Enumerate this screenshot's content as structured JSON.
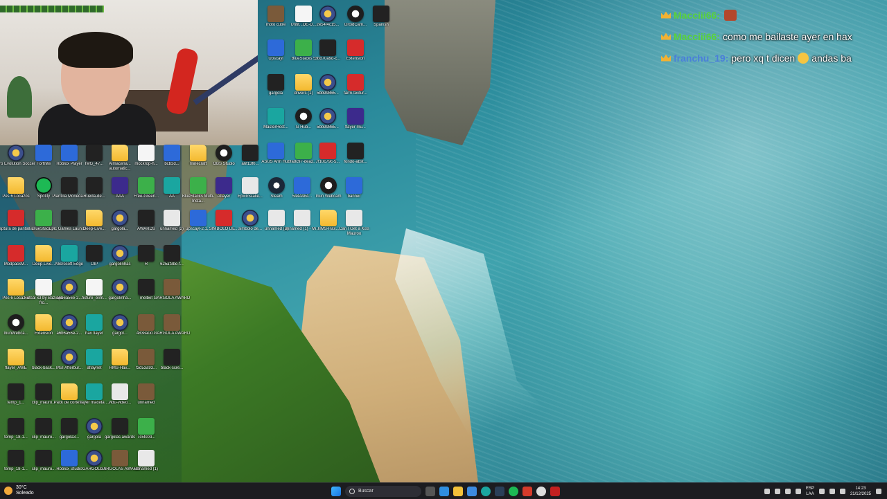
{
  "webcam": {
    "label": ""
  },
  "desktop_icons": [
    {
      "label": "moto cutre",
      "glyph": "g-gif"
    },
    {
      "label": "Untit...DE-D...",
      "glyph": "g-doc"
    },
    {
      "label": "2e54f4c15...",
      "glyph": "g-gold"
    },
    {
      "label": "DroidCam...",
      "glyph": "g-obs"
    },
    {
      "label": "Spanish",
      "glyph": "g-dark"
    },
    {
      "label": "Upscayl",
      "glyph": "g-blue"
    },
    {
      "label": "BlueStacks 5",
      "glyph": "g-green"
    },
    {
      "label": "3bd70a9d-c...",
      "glyph": "g-dark"
    },
    {
      "label": "Extension",
      "glyph": "g-red"
    },
    {
      "label": "gargola",
      "glyph": "g-dark"
    },
    {
      "label": "drivers (1)",
      "glyph": "g-folder"
    },
    {
      "label": "5bb99865...",
      "glyph": "g-gold"
    },
    {
      "label": "farm-textur...",
      "glyph": "g-red"
    },
    {
      "label": "MasterHost...",
      "glyph": "g-teal"
    },
    {
      "label": "G Hub...",
      "glyph": "g-obs"
    },
    {
      "label": "5bb99865...",
      "glyph": "g-gold"
    },
    {
      "label": "flayer mu...",
      "glyph": "g-purple"
    },
    {
      "label": "ASUS Arm Hub",
      "glyph": "g-blue"
    },
    {
      "label": "fa8c97-dea2...",
      "glyph": "g-green"
    },
    {
      "label": "7f10c79c-5...",
      "glyph": "g-red"
    },
    {
      "label": "fondo-abst...",
      "glyph": "g-dark"
    },
    {
      "label": "Pro Evolution Soccer",
      "glyph": "g-gold"
    },
    {
      "label": "Fortnite",
      "glyph": "g-blue"
    },
    {
      "label": "Roblox Player",
      "glyph": "g-blue"
    },
    {
      "label": "IMG_47...",
      "glyph": "g-dark"
    },
    {
      "label": "Almacena... automatic...",
      "glyph": "g-folder"
    },
    {
      "label": "mockrop-h...",
      "glyph": "g-doc"
    },
    {
      "label": "bcb3d...",
      "glyph": "g-blue"
    },
    {
      "label": "minecraft",
      "glyph": "g-folder"
    },
    {
      "label": "OBS Studio",
      "glyph": "g-obs"
    },
    {
      "label": "a6f13f0...",
      "glyph": "g-dark"
    },
    {
      "label": "Pes 6 Locazos",
      "glyph": "g-folder"
    },
    {
      "label": "Spotify",
      "glyph": "g-spot"
    },
    {
      "label": "Plantilla Moneda...",
      "glyph": "g-dark"
    },
    {
      "label": "Rueda-de...",
      "glyph": "g-dark"
    },
    {
      "label": "AAA",
      "glyph": "g-purple"
    },
    {
      "label": "Free-Green...",
      "glyph": "g-green"
    },
    {
      "label": "AA",
      "glyph": "g-teal"
    },
    {
      "label": "BlueStacks Multi-Insta...",
      "glyph": "g-green"
    },
    {
      "label": "Aflayer",
      "glyph": "g-purple"
    },
    {
      "label": "EpicInstalle...",
      "glyph": "g-lightdoc"
    },
    {
      "label": "Steam",
      "glyph": "g-steam"
    },
    {
      "label": "5444484...",
      "glyph": "g-blue"
    },
    {
      "label": "Iriun Webcam",
      "glyph": "g-obs"
    },
    {
      "label": "banner",
      "glyph": "g-blue"
    },
    {
      "label": "Captura de pantalla...",
      "glyph": "g-red"
    },
    {
      "label": "BlueStacksX",
      "glyph": "g-green"
    },
    {
      "label": "Epic Games Launcher",
      "glyph": "g-dark"
    },
    {
      "label": "Deep-Live...",
      "glyph": "g-folder"
    },
    {
      "label": "gargola...",
      "glyph": "g-gold"
    },
    {
      "label": "AWARDS",
      "glyph": "g-dark"
    },
    {
      "label": "unnamed (2)",
      "glyph": "g-lightdoc"
    },
    {
      "label": "upscayl-2.1...",
      "glyph": "g-blue"
    },
    {
      "label": "SIMBOLO DE...",
      "glyph": "g-red"
    },
    {
      "label": "simbolo de...",
      "glyph": "g-gold"
    },
    {
      "label": "unnamed (2)",
      "glyph": "g-lightdoc"
    },
    {
      "label": "unnamed (1) - Mi...",
      "glyph": "g-lightdoc"
    },
    {
      "label": "HMS-Hax...",
      "glyph": "g-folder"
    },
    {
      "label": "Can I Get a Kiss Mauroo",
      "glyph": "g-lightdoc"
    },
    {
      "label": "ModpackM...",
      "glyph": "g-red"
    },
    {
      "label": "Deep-Live...",
      "glyph": "g-folder"
    },
    {
      "label": "Microsoft Edge",
      "glyph": "g-teal"
    },
    {
      "label": "OIP",
      "glyph": "g-dark"
    },
    {
      "label": "gargolinhas",
      "glyph": "g-gold"
    },
    {
      "label": "R",
      "glyph": "g-dark"
    },
    {
      "label": "625af3be-f...",
      "glyph": "g-dark"
    },
    {
      "label": "Pes 6 Locazos",
      "glyph": "g-folder"
    },
    {
      "label": "Futsal x3 by Bazinga fro...",
      "glyph": "g-doc"
    },
    {
      "label": "a6b6a56e-2...",
      "glyph": "g-gold"
    },
    {
      "label": "fixture_elim...",
      "glyph": "g-doc"
    },
    {
      "label": "gargolinha...",
      "glyph": "g-gold"
    },
    {
      "label": "melbet",
      "glyph": "g-dark"
    },
    {
      "label": "GARGOLA AWARD",
      "glyph": "g-gif"
    },
    {
      "label": "IriunWebca...",
      "glyph": "g-obs"
    },
    {
      "label": "Extension",
      "glyph": "g-folder"
    },
    {
      "label": "a6b6a56e-2...",
      "glyph": "g-gold"
    },
    {
      "label": "hax flayer",
      "glyph": "g-teal"
    },
    {
      "label": "gargol...",
      "glyph": "g-gold"
    },
    {
      "label": "4838a0d...",
      "glyph": "g-gif"
    },
    {
      "label": "GARGOLA AWARD",
      "glyph": "g-gif"
    },
    {
      "label": "flayer_AWE",
      "glyph": "g-folder"
    },
    {
      "label": "black-back...",
      "glyph": "g-dark"
    },
    {
      "label": "MSI Afterbur...",
      "glyph": "g-gold"
    },
    {
      "label": "aflaynet",
      "glyph": "g-teal"
    },
    {
      "label": "HMS-Hax...",
      "glyph": "g-folder"
    },
    {
      "label": "f3d53a93...",
      "glyph": "g-gif"
    },
    {
      "label": "black-scre...",
      "glyph": "g-dark"
    },
    {
      "label": "temp_1...",
      "glyph": "g-dark"
    },
    {
      "label": "clip_mauro...",
      "glyph": "g-dark"
    },
    {
      "label": "Pack de cortes...",
      "glyph": "g-folder"
    },
    {
      "label": "flayer maceta ...",
      "glyph": "g-teal"
    },
    {
      "label": "vidu-video...",
      "glyph": "g-lightdoc"
    },
    {
      "label": "unnamed",
      "glyph": "g-gif"
    },
    {
      "label": "temp_18-1...",
      "glyph": "g-dark"
    },
    {
      "label": "clip_mauro...",
      "glyph": "g-dark"
    },
    {
      "label": "gargola3...",
      "glyph": "g-dark"
    },
    {
      "label": "gargola",
      "glyph": "g-gold"
    },
    {
      "label": "gargolas awards",
      "glyph": "g-dark"
    },
    {
      "label": "7c5fc0d...",
      "glyph": "g-green"
    },
    {
      "label": "temp_18-1...",
      "glyph": "g-dark"
    },
    {
      "label": "clip_mauro...",
      "glyph": "g-dark"
    },
    {
      "label": "Roblox Studio",
      "glyph": "g-blue"
    },
    {
      "label": "GARGOLA 3",
      "glyph": "g-gold"
    },
    {
      "label": "GARGOLAS AWARD",
      "glyph": "g-gif"
    },
    {
      "label": "unnamed (1)",
      "glyph": "g-lightdoc"
    }
  ],
  "chat": [
    {
      "user": "Macciii66:",
      "user_color": "#59d23a",
      "message": "",
      "emote": "true",
      "emoji": "false"
    },
    {
      "user": "Macciii66:",
      "user_color": "#59d23a",
      "message": "como me bailaste ayer en hax",
      "emote": "false",
      "emoji": "false"
    },
    {
      "user": "franchu_19:",
      "user_color": "#4a7fd9",
      "message_before": "pero xq t dicen",
      "message": "andas ba",
      "emote": "false",
      "emoji": "true"
    }
  ],
  "taskbar": {
    "weather_temp": "30°C",
    "weather_desc": "Soleado",
    "search_placeholder": "Buscar",
    "lang_top": "ESP",
    "lang_bottom": "LAA",
    "time": "14:23",
    "date": "21/12/2025"
  },
  "colors": {
    "taskbar_bg": "#1c1c20",
    "chat_user_green": "#59d23a",
    "chat_user_blue": "#4a7fd9"
  }
}
